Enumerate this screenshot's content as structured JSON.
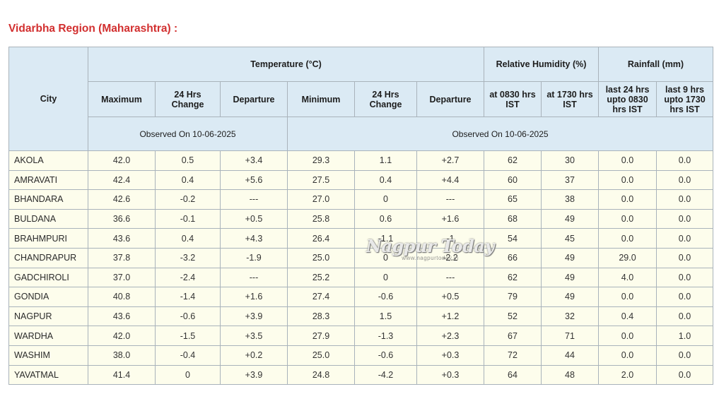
{
  "region_title": "Vidarbha Region (Maharashtra) :",
  "headers": {
    "city": "City",
    "temperature": "Temperature (°C)",
    "humidity": "Relative Humidity (%)",
    "rainfall": "Rainfall (mm)",
    "maximum": "Maximum",
    "change_24": "24 Hrs Change",
    "departure": "Departure",
    "minimum": "Minimum",
    "change_24_min": "24 Hrs Change",
    "departure_min": "Departure",
    "rh_0830": "at 0830 hrs IST",
    "rh_1730": "at 1730 hrs IST",
    "rain_24": "last 24 hrs upto 0830 hrs IST",
    "rain_9": "last 9 hrs upto 1730 hrs IST",
    "observed_max": "Observed On 10-06-2025",
    "observed_min": "Observed On 10-06-2025"
  },
  "rows": [
    [
      "AKOLA",
      "42.0",
      "0.5",
      "+3.4",
      "29.3",
      "1.1",
      "+2.7",
      "62",
      "30",
      "0.0",
      "0.0"
    ],
    [
      "AMRAVATI",
      "42.4",
      "0.4",
      "+5.6",
      "27.5",
      "0.4",
      "+4.4",
      "60",
      "37",
      "0.0",
      "0.0"
    ],
    [
      "BHANDARA",
      "42.6",
      "-0.2",
      "---",
      "27.0",
      "0",
      "---",
      "65",
      "38",
      "0.0",
      "0.0"
    ],
    [
      "BULDANA",
      "36.6",
      "-0.1",
      "+0.5",
      "25.8",
      "0.6",
      "+1.6",
      "68",
      "49",
      "0.0",
      "0.0"
    ],
    [
      "BRAHMPURI",
      "43.6",
      "0.4",
      "+4.3",
      "26.4",
      "-1.1",
      "-1",
      "54",
      "45",
      "0.0",
      "0.0"
    ],
    [
      "CHANDRAPUR",
      "37.8",
      "-3.2",
      "-1.9",
      "25.0",
      "0",
      "-2.2",
      "66",
      "49",
      "29.0",
      "0.0"
    ],
    [
      "GADCHIROLI",
      "37.0",
      "-2.4",
      "---",
      "25.2",
      "0",
      "---",
      "62",
      "49",
      "4.0",
      "0.0"
    ],
    [
      "GONDIA",
      "40.8",
      "-1.4",
      "+1.6",
      "27.4",
      "-0.6",
      "+0.5",
      "79",
      "49",
      "0.0",
      "0.0"
    ],
    [
      "NAGPUR",
      "43.6",
      "-0.6",
      "+3.9",
      "28.3",
      "1.5",
      "+1.2",
      "52",
      "32",
      "0.4",
      "0.0"
    ],
    [
      "WARDHA",
      "42.0",
      "-1.5",
      "+3.5",
      "27.9",
      "-1.3",
      "+2.3",
      "67",
      "71",
      "0.0",
      "1.0"
    ],
    [
      "WASHIM",
      "38.0",
      "-0.4",
      "+0.2",
      "25.0",
      "-0.6",
      "+0.3",
      "72",
      "44",
      "0.0",
      "0.0"
    ],
    [
      "YAVATMAL",
      "41.4",
      "0",
      "+3.9",
      "24.8",
      "-4.2",
      "+0.3",
      "64",
      "48",
      "2.0",
      "0.0"
    ]
  ],
  "watermark": {
    "logo": "Nagpur Today",
    "url": "www.nagpurtoday.in"
  }
}
